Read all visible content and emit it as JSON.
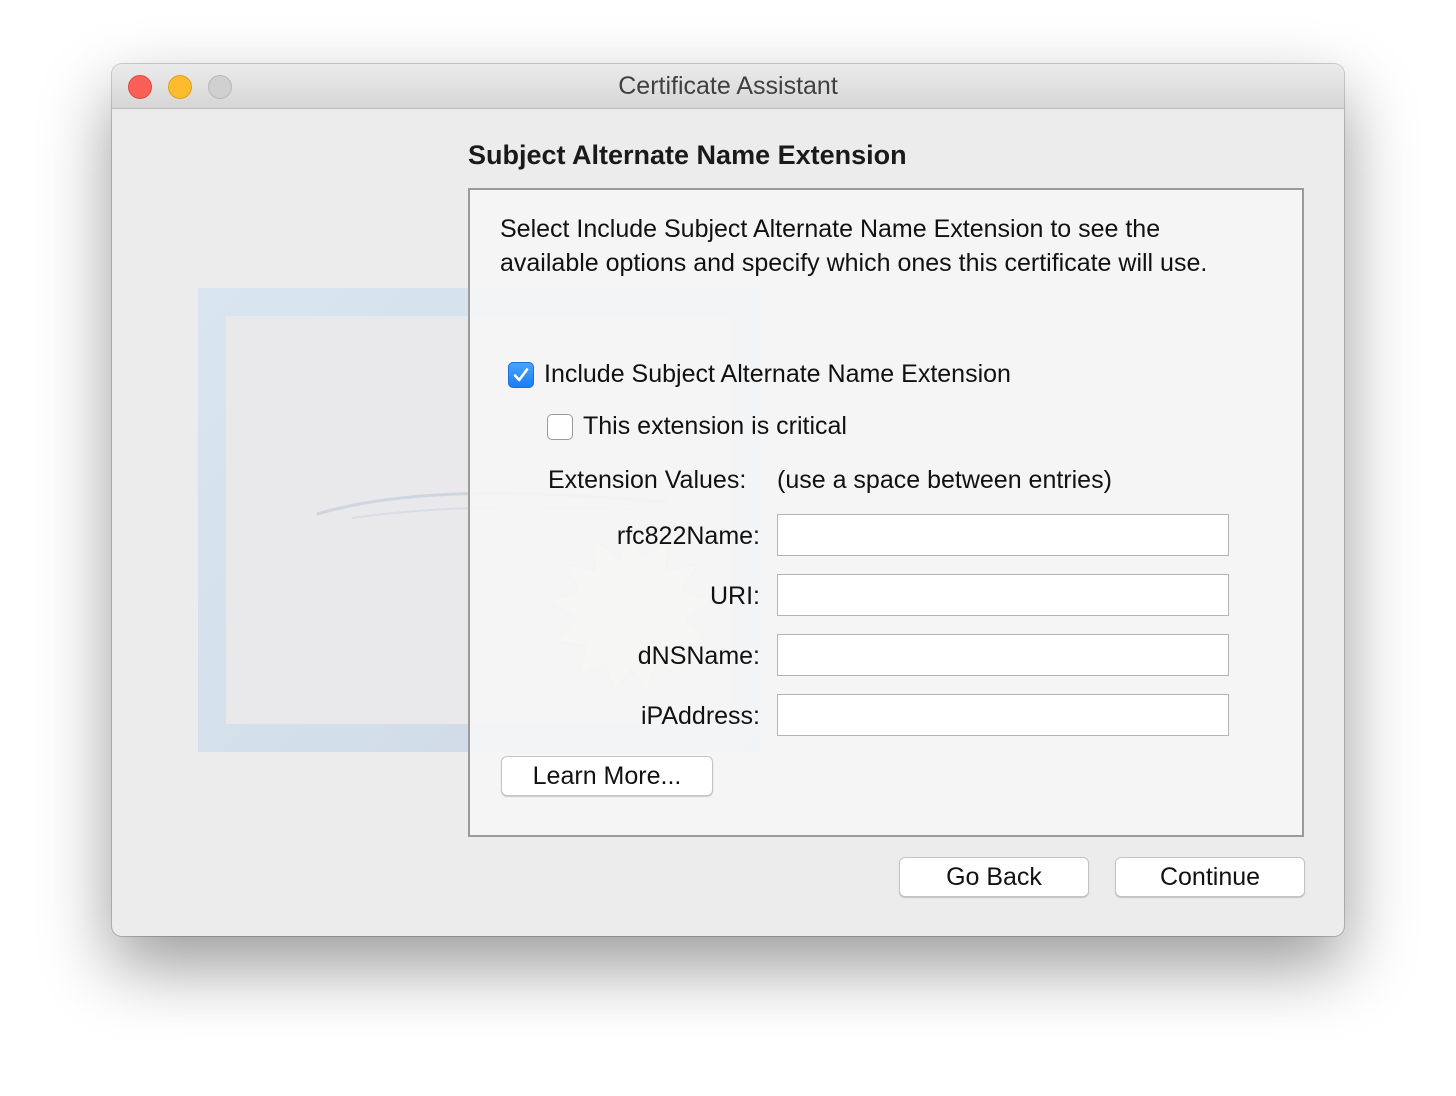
{
  "window": {
    "title": "Certificate Assistant"
  },
  "page": {
    "title": "Subject Alternate Name Extension",
    "description": "Select Include Subject Alternate Name Extension to see the available options and specify which ones this certificate will use."
  },
  "options": {
    "include_extension_label": "Include Subject Alternate Name Extension",
    "include_extension_checked": true,
    "critical_label": "This extension is critical",
    "critical_checked": false
  },
  "extension_values": {
    "label": "Extension Values:",
    "hint": "(use a space between entries)",
    "fields": [
      {
        "label": "rfc822Name:",
        "value": ""
      },
      {
        "label": "URI:",
        "value": ""
      },
      {
        "label": "dNSName:",
        "value": ""
      },
      {
        "label": "iPAddress:",
        "value": ""
      }
    ]
  },
  "buttons": {
    "learn_more": "Learn More...",
    "go_back": "Go Back",
    "continue": "Continue"
  },
  "colors": {
    "close": "#fc5f57",
    "minimize": "#fdbc2e",
    "zoom": "#d0d0d0",
    "checkbox_accent": "#1b7df5"
  }
}
